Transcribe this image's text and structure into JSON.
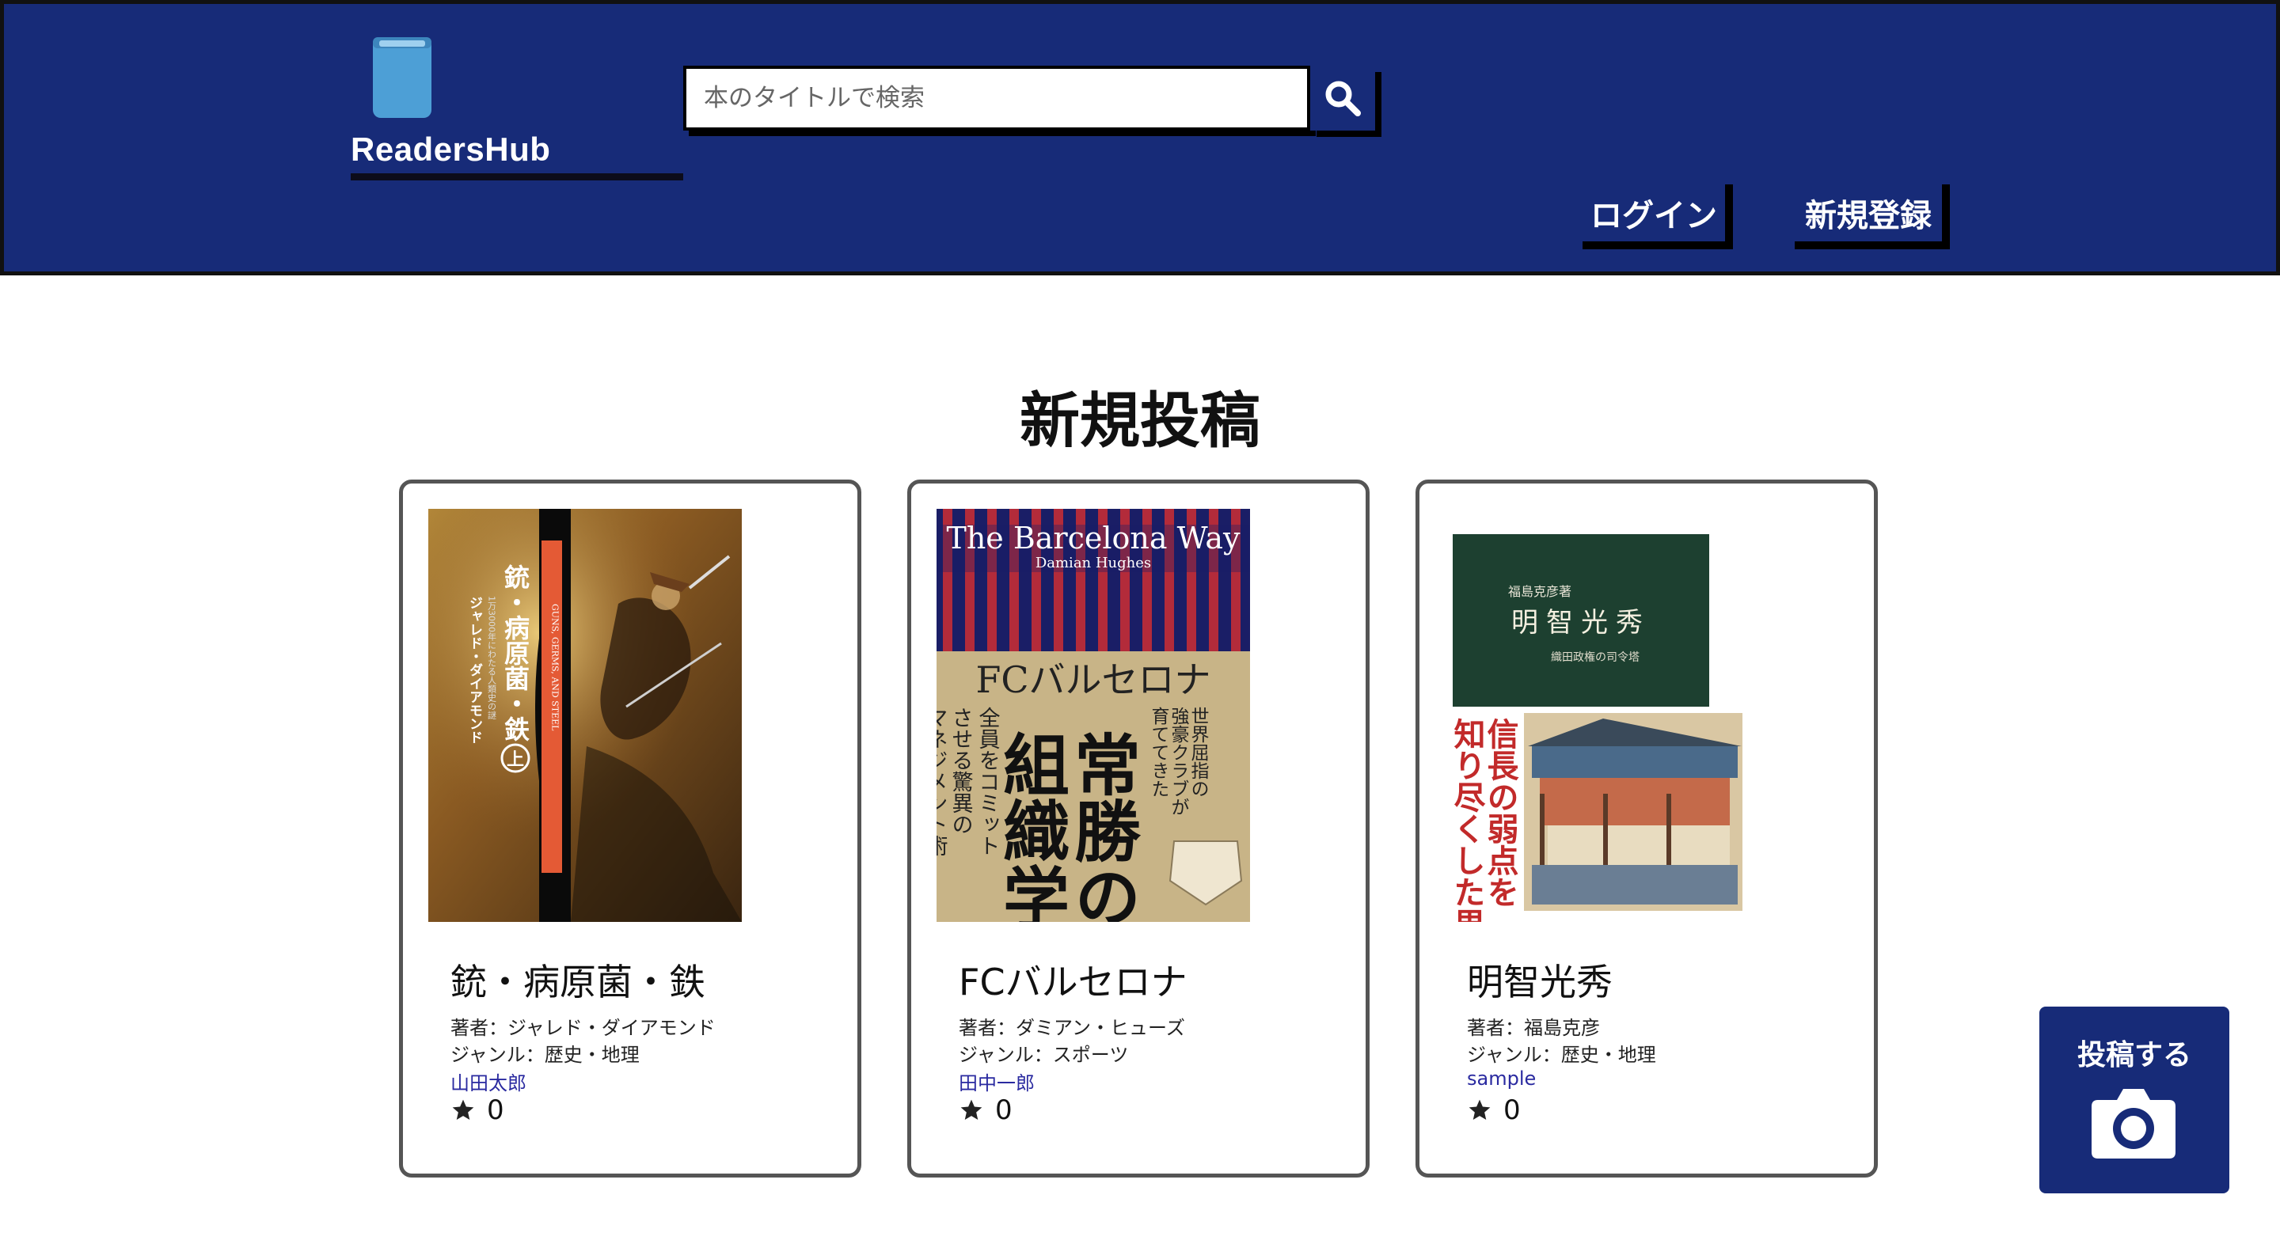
{
  "header": {
    "logo_text": "ReadersHub",
    "logo_icon": "book-icon",
    "search_placeholder": "本のタイトルで検索",
    "search_icon": "search-icon",
    "nav": {
      "login": "ログイン",
      "signup": "新規登録"
    },
    "colors": {
      "header_bg": "#172b78",
      "logo_book": "#4d9fd6"
    }
  },
  "main": {
    "title": "新規投稿",
    "posts": [
      {
        "title": "銃・病原菌・鉄",
        "author": "著者：ジャレド・ダイアモンド",
        "genre": "ジャンル：歴史・地理",
        "user": "山田太郎",
        "likes": "0",
        "cover": {
          "title": "銃・病原菌・鉄",
          "subtitle": "上",
          "author": "ジャレド・ダイアモンド",
          "english": "GUNS, GERMS, AND STEEL"
        }
      },
      {
        "title": "FCバルセロナ",
        "author": "著者：ダミアン・ヒューズ",
        "genre": "ジャンル：スポーツ",
        "user": "田中一郎",
        "likes": "0",
        "cover": {
          "en_title": "The Barcelona Way",
          "en_author": "Damian Hughes",
          "heading": "FCバルセロナ",
          "big": "常勝の組織学",
          "sub": "全員をコミットさせる驚異のマネジメント術"
        }
      },
      {
        "title": "明智光秀",
        "author": "著者：福島克彦",
        "genre": "ジャンル：歴史・地理",
        "user": "sample",
        "likes": "0",
        "cover": {
          "author": "福島克彦著",
          "title": "明智光秀",
          "subtitle": "織田政権の司令塔",
          "tagline": "信長の弱点を知り尽くした男"
        }
      }
    ]
  },
  "post_button": {
    "label": "投稿する",
    "icon": "camera-icon"
  },
  "like_icon": "star-icon"
}
